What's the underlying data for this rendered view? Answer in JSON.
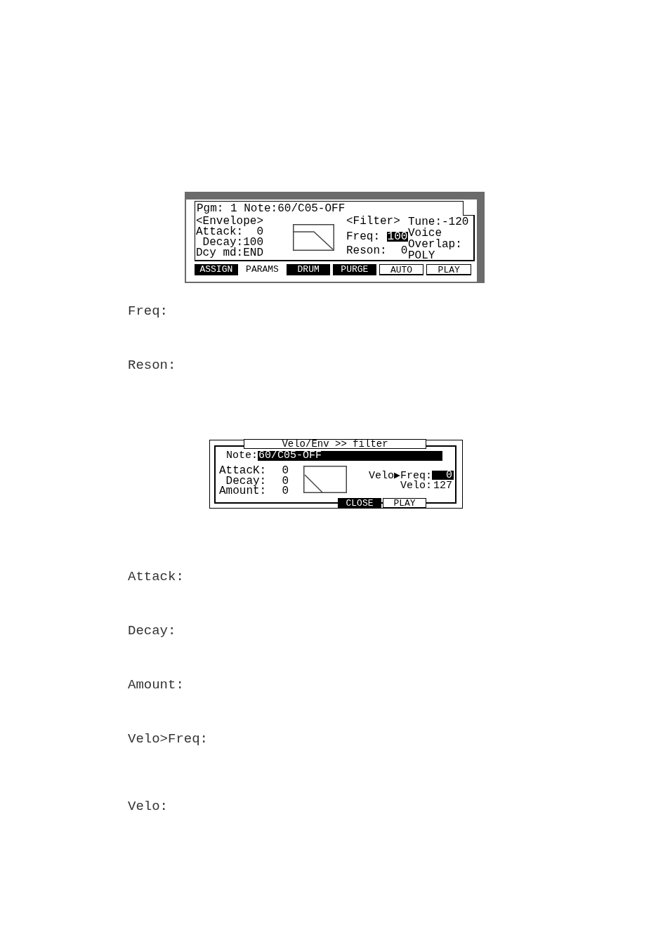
{
  "sections": [
    {
      "screen": {
        "kind": "program",
        "header": "Pgm: 1 Note:60/C05-OFF",
        "envelope": {
          "title": "<Envelope>",
          "rows": [
            {
              "label": "Attack:",
              "value": "0"
            },
            {
              "label": "Decay:",
              "value": "100"
            },
            {
              "label": "Dcy md:",
              "value": "END"
            }
          ]
        },
        "filter": {
          "title": "<Filter>",
          "rows": [
            {
              "label": "Freq:",
              "value": "100",
              "selected": true
            },
            {
              "label": "Reson:",
              "value": "0",
              "selected": false
            }
          ]
        },
        "tune": {
          "label": "Tune:",
          "value": "-120"
        },
        "voice_overlap": {
          "label_lines": [
            "Voice",
            "Overlap:"
          ],
          "value": "POLY"
        },
        "soft_keys": [
          {
            "label": "ASSIGN",
            "kind": "tab",
            "selected": false
          },
          {
            "label": "PARAMS",
            "kind": "tab",
            "selected": true
          },
          {
            "label": "DRUM",
            "kind": "tab",
            "selected": false
          },
          {
            "label": "PURGE",
            "kind": "tab",
            "selected": false
          },
          {
            "label": "AUTO",
            "kind": "button",
            "selected": false
          },
          {
            "label": "PLAY",
            "kind": "button",
            "selected": false
          }
        ]
      },
      "parameters": [
        "Freq:",
        "Reson:"
      ]
    },
    {
      "screen": {
        "kind": "dialog",
        "title": "Velo/Env >> filter",
        "note": {
          "label": "Note:",
          "value": "60/C05-OFF",
          "selected": true
        },
        "envelope": {
          "rows": [
            {
              "label": "AttacK:",
              "value": "0"
            },
            {
              "label": "Decay:",
              "value": "0"
            },
            {
              "label": "Amount:",
              "value": "0"
            }
          ]
        },
        "velocity": [
          {
            "label": "Velo▶Freq:",
            "value": "0",
            "selected": true
          },
          {
            "label": "Velo:",
            "value": "127",
            "selected": false
          }
        ],
        "buttons": [
          {
            "label": "CLOSE",
            "selected": true
          },
          {
            "label": "PLAY",
            "selected": false
          }
        ]
      },
      "parameters": [
        "Attack:",
        "Decay:",
        "Amount:",
        "Velo>Freq:",
        "Velo:"
      ]
    }
  ]
}
